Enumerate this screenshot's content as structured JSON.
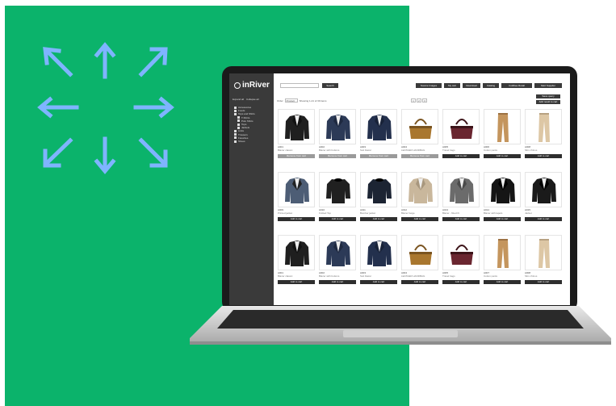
{
  "colors": {
    "green": "#0bb36b",
    "arrow": "#7fb4ff",
    "dark": "#3a3a3a"
  },
  "app": {
    "logo_text": "inRiver",
    "tree_actions": [
      "Expand all",
      "Collapse all"
    ],
    "tree": [
      {
        "label": "Accessories",
        "child": false
      },
      {
        "label": "Foods",
        "child": false
      },
      {
        "label": "Tops and Shirts",
        "child": false
      },
      {
        "label": "T-Shirts",
        "child": true
      },
      {
        "label": "Polo Shirts",
        "child": true
      },
      {
        "label": "Tops",
        "child": true
      },
      {
        "label": "Jackets",
        "child": true
      },
      {
        "label": "Links",
        "child": false
      },
      {
        "label": "Trousers",
        "child": false
      },
      {
        "label": "Favorites",
        "child": false
      },
      {
        "label": "Shoes",
        "child": false
      }
    ],
    "search": {
      "placeholder": "",
      "button": "Search"
    },
    "toolbar": {
      "source_images": "Source Images",
      "my_cart": "My cart",
      "download": "Download",
      "catalog": "Catalog",
      "customer": "Coldbee Retail",
      "supplier": "Mert Supplier"
    },
    "sort": {
      "label": "Order",
      "value": "Product",
      "summary": "Showing 1-21 of 39 items"
    },
    "pages": [
      "1",
      "2",
      "3"
    ],
    "side_buttons": [
      "Save query",
      "Add result to cart"
    ],
    "add_label": "Add to cart",
    "remove_label": "Remove from cart"
  },
  "products": [
    {
      "id": "A001",
      "name": "Blazer classic",
      "kind": "blazer-dark",
      "button": "remove"
    },
    {
      "id": "A002",
      "name": "Blazer with buttons",
      "kind": "blazer-navy",
      "button": "remove"
    },
    {
      "id": "A003",
      "name": "Suit blazer",
      "kind": "blazer-navy2",
      "button": "remove"
    },
    {
      "id": "A004",
      "name": "LEATHER HANDBAG",
      "kind": "bag-brown",
      "button": "remove"
    },
    {
      "id": "A005",
      "name": "Travel bags",
      "kind": "bag-plaid",
      "button": "add"
    },
    {
      "id": "A006",
      "name": "Cotton pants",
      "kind": "pants-tan",
      "button": "add"
    },
    {
      "id": "A008",
      "name": "Slim chinos",
      "kind": "pants-beige",
      "button": "add"
    },
    {
      "id": "A009",
      "name": "Printed jacket",
      "kind": "jacket-print",
      "button": "add"
    },
    {
      "id": "A010",
      "name": "Knitted Top",
      "kind": "sweater-black",
      "button": "add"
    },
    {
      "id": "A011",
      "name": "Bomber jacket",
      "kind": "bomber",
      "button": "add"
    },
    {
      "id": "A012",
      "name": "Blazer beige",
      "kind": "blazer-beige",
      "button": "add"
    },
    {
      "id": "A013",
      "name": "Blazer - fitted fit",
      "kind": "blazer-grey",
      "button": "add"
    },
    {
      "id": "A014",
      "name": "Blazer with lapels",
      "kind": "blazer-black",
      "button": "add"
    },
    {
      "id": "A015",
      "name": "Jacket",
      "kind": "jacket-black",
      "button": "add"
    },
    {
      "id": "A001",
      "name": "Blazer classic",
      "kind": "blazer-dark",
      "button": "add"
    },
    {
      "id": "A002",
      "name": "Blazer with buttons",
      "kind": "blazer-navy",
      "button": "add"
    },
    {
      "id": "A003",
      "name": "Suit blazer",
      "kind": "blazer-navy2",
      "button": "add"
    },
    {
      "id": "A004",
      "name": "LEATHER HANDBAG",
      "kind": "bag-brown",
      "button": "add"
    },
    {
      "id": "A005",
      "name": "Travel bags",
      "kind": "bag-plaid",
      "button": "add"
    },
    {
      "id": "A007",
      "name": "Cotton pants",
      "kind": "pants-tan",
      "button": "add"
    },
    {
      "id": "A008",
      "name": "Slim chinos",
      "kind": "pants-beige",
      "button": "add"
    }
  ]
}
